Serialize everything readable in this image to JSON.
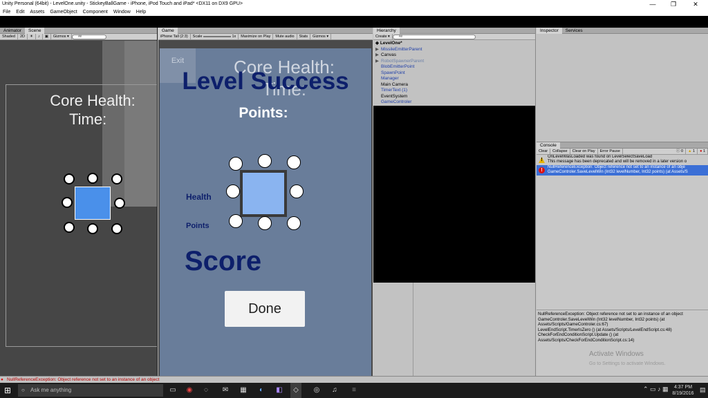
{
  "window": {
    "title": "Unity Personal (64bit) - LevelOne.unity - StickeyBallGame - iPhone, iPod Touch and iPad* <DX11 on DX9 GPU>",
    "minimize_glyph": "—",
    "maximize_glyph": "❐",
    "close_glyph": "✕"
  },
  "menu": [
    "File",
    "Edit",
    "Assets",
    "GameObject",
    "Component",
    "Window",
    "Help"
  ],
  "scene_panel": {
    "tabs": [
      "Animator",
      "Scene"
    ],
    "toolbar": [
      "Shaded",
      "2D",
      "Gizmos ▾"
    ],
    "search": "All",
    "text_health": "Core Health:",
    "text_time": "Time:"
  },
  "game_panel": {
    "tab": "Game",
    "toolbar": [
      "iPhone Tall (2:3)",
      "Scale",
      "1x",
      "Maximize on Play",
      "Mute audio",
      "Stats",
      "Gizmos ▾"
    ],
    "exit_label": "Exit",
    "core_health": "Core Health:",
    "level_success": "Level Success",
    "time": "Time:",
    "points_title": "Points:",
    "health_label": "Health",
    "points_label": "Points",
    "score": "Score",
    "done_button": "Done"
  },
  "hierarchy": {
    "tab": "Hierarchy",
    "create": "Create ▾",
    "search": "All",
    "scene": "LevelOne*",
    "items": [
      {
        "label": "MissileEmitterParent",
        "arrow": "▶",
        "style": "blue"
      },
      {
        "label": "Canvas",
        "arrow": "▶",
        "style": "black"
      },
      {
        "label": "RobotSpawnerParent",
        "arrow": "▶",
        "style": "grey"
      },
      {
        "label": "BlobEmitterPoint",
        "arrow": "",
        "style": "blue"
      },
      {
        "label": "SpawnPoint",
        "arrow": "",
        "style": "blue"
      },
      {
        "label": "Manager",
        "arrow": "",
        "style": "blue"
      },
      {
        "label": "Main Camera",
        "arrow": "",
        "style": "black"
      },
      {
        "label": "TimerText (1)",
        "arrow": "",
        "style": "blue"
      },
      {
        "label": "EventSystem",
        "arrow": "",
        "style": "black"
      },
      {
        "label": "GameControler",
        "arrow": "",
        "style": "blue"
      }
    ]
  },
  "inspector": {
    "tabs": [
      "Inspector",
      "Services"
    ]
  },
  "console": {
    "tab": "Console",
    "buttons": [
      "Clear",
      "Collapse",
      "Clear on Play",
      "Error Pause"
    ],
    "counts": [
      "0",
      "1",
      "1"
    ],
    "entries": [
      {
        "line1": "OnLevelWasLoaded was found on LevelSelectSaveLoad",
        "line2": "This message has been deprecated and will be removed in a later version o",
        "type": "warning"
      },
      {
        "line1": "NullReferenceException: Object reference not set to an instance of an obje",
        "line2": "GameControler.SaveLevelWin (Int32 levelNumber, Int32 points) (at Assets/S",
        "type": "error"
      }
    ],
    "detail": [
      "NullReferenceException: Object reference not set to an instance of an object",
      "GameControler.SaveLevelWin (Int32 levelNumber, Int32 points) (at",
      "Assets/Scripts/GameControler.cs:67)",
      "LevelEndScript.TimerIsZero () (at Assets/Scripts/LevelEndScript.cs:48)",
      "CheckForEndConditionScript.Update () (at",
      "Assets/Scripts/CheckForEndConditionScript.cs:14)"
    ],
    "watermark_title": "Activate Windows",
    "watermark_sub": "Go to Settings to activate Windows."
  },
  "status_bar": "NullReferenceException: Object reference not set to an instance of an object",
  "taskbar": {
    "search_placeholder": "Ask me anything",
    "time": "4:37 PM",
    "date": "8/19/2016"
  },
  "colors": {
    "game_background": "#697d9a",
    "navy_text": "#0d1f6b",
    "square_fill": "#8ab4f0",
    "scene_square": "#4a90ea",
    "selected_row": "#3b6fd6"
  }
}
